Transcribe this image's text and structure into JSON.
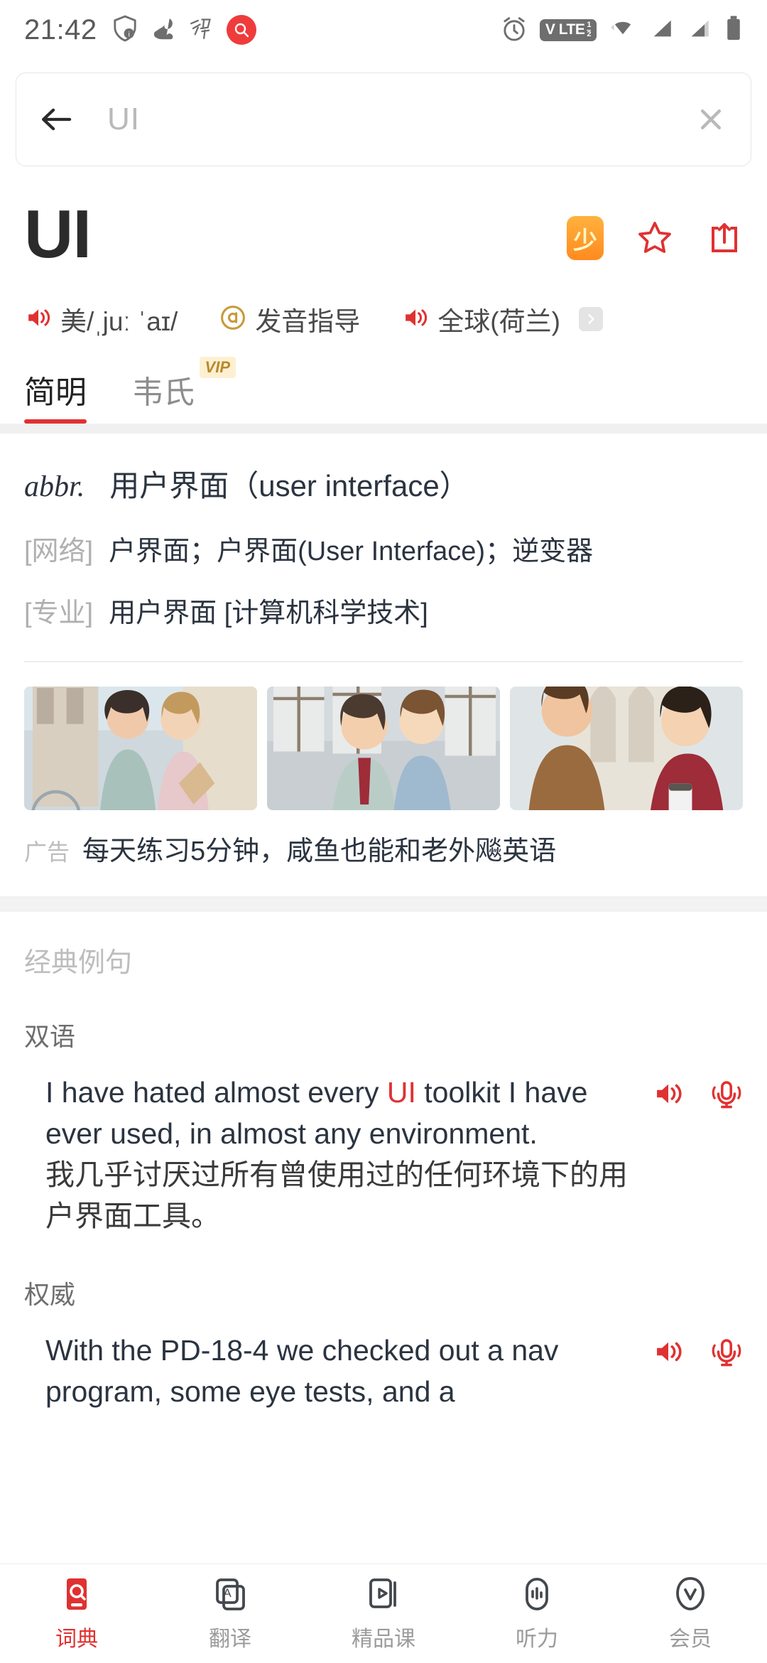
{
  "statusbar": {
    "time": "21:42",
    "left_icons": [
      "shield-info-icon",
      "squirrel-icon",
      "calligraphy-xuexi-icon",
      "red-search-circle-icon"
    ],
    "right_icons": [
      "alarm-icon",
      "volte-badge",
      "wifi-icon",
      "signal-1-icon",
      "signal-2-icon",
      "battery-icon"
    ],
    "volte_label": "V LTE",
    "volte_sim": "1/2"
  },
  "search": {
    "value": "UI",
    "placeholder": "UI",
    "back_icon": "back-arrow-icon",
    "clear_icon": "close-icon"
  },
  "entry": {
    "headword": "UI",
    "badge_shao": "少",
    "star_icon": "star-icon",
    "share_icon": "share-icon"
  },
  "pronunciation": [
    {
      "icon": "speaker-icon",
      "label": "美/ˌjuː ˈaɪ/"
    },
    {
      "icon": "pronunciation-guide-icon",
      "label": "发音指导"
    },
    {
      "icon": "speaker-icon",
      "label": "全球(荷兰)"
    }
  ],
  "tabs": [
    {
      "label": "简明",
      "active": true,
      "vip": false
    },
    {
      "label": "韦氏",
      "active": false,
      "vip": true,
      "vip_label": "VIP"
    }
  ],
  "definitions": {
    "pos": "abbr.",
    "main": "用户界面（user interface）",
    "rows": [
      {
        "tag": "[网络]",
        "text": "户界面；户界面(User Interface)；逆变器"
      },
      {
        "tag": "[专业]",
        "text": "用户界面 [计算机科学技术]"
      }
    ]
  },
  "ad": {
    "label": "广告",
    "text": "每天练习5分钟，咸鱼也能和老外飚英语",
    "images": [
      "two-women-walking-bicycle-photo",
      "two-women-talking-street-photo",
      "man-and-woman-conversation-photo"
    ]
  },
  "examples": {
    "section_title": "经典例句",
    "groups": [
      {
        "label": "双语",
        "en_before": "I have hated almost every ",
        "en_highlight": "UI",
        "en_after": " toolkit I have ever used, in almost any environment.",
        "cn": "我几乎讨厌过所有曾使用过的任何环境下的用户界面工具。",
        "speaker_icon": "speaker-icon",
        "mic_icon": "microphone-icon"
      },
      {
        "label": "权威",
        "en_before": "With the PD-18-4 we checked out a nav program, some eye tests, and a",
        "en_highlight": "",
        "en_after": "",
        "cn": "",
        "speaker_icon": "speaker-icon",
        "mic_icon": "microphone-icon"
      }
    ]
  },
  "bottomnav": [
    {
      "label": "词典",
      "icon": "dictionary-icon",
      "active": true
    },
    {
      "label": "翻译",
      "icon": "translate-icon",
      "active": false
    },
    {
      "label": "精品课",
      "icon": "course-video-icon",
      "active": false
    },
    {
      "label": "听力",
      "icon": "listening-icon",
      "active": false
    },
    {
      "label": "会员",
      "icon": "vip-member-icon",
      "active": false
    }
  ],
  "colors": {
    "accent_red": "#e03131",
    "brand_red": "#ef3b3b",
    "orange": "#ff8a1f",
    "vip_gold": "#b8892a"
  }
}
